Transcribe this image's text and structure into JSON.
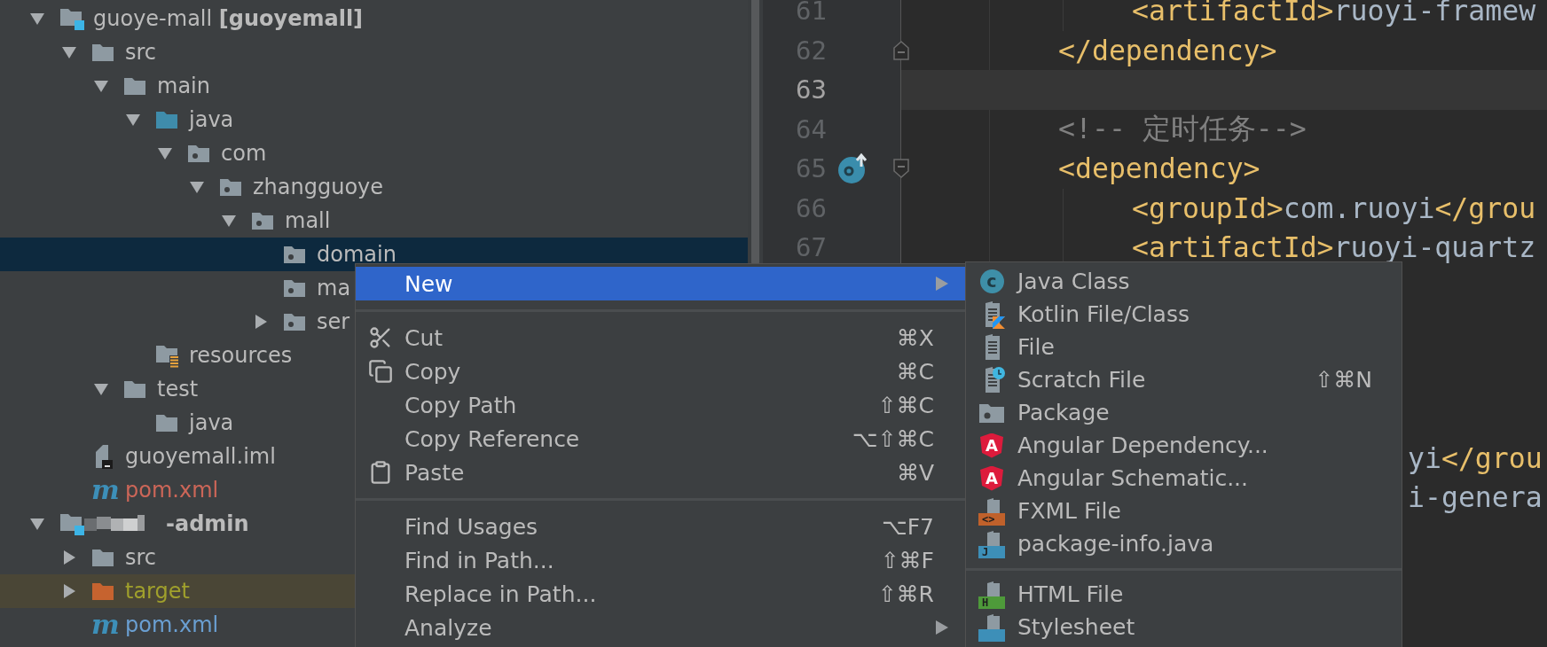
{
  "project_tree": {
    "items": [
      {
        "label": "guoye-mall **[guoyemall]**",
        "kind": "module",
        "expanded": true,
        "selected": false,
        "children": [
          {
            "label": "src",
            "kind": "folder",
            "expanded": true,
            "selected": false,
            "children": [
              {
                "label": "main",
                "kind": "folder",
                "expanded": true,
                "selected": false,
                "children": [
                  {
                    "label": "java",
                    "kind": "source-folder",
                    "expanded": true,
                    "selected": false,
                    "children": [
                      {
                        "label": "com",
                        "kind": "package",
                        "expanded": true,
                        "selected": false,
                        "children": [
                          {
                            "label": "zhangguoye",
                            "kind": "package",
                            "expanded": true,
                            "selected": false,
                            "children": [
                              {
                                "label": "mall",
                                "kind": "package",
                                "expanded": true,
                                "selected": false,
                                "children": [
                                  {
                                    "label": "domain",
                                    "kind": "package",
                                    "selected": true
                                  },
                                  {
                                    "label": "ma",
                                    "kind": "package",
                                    "selected": false
                                  },
                                  {
                                    "label": "ser",
                                    "kind": "package",
                                    "expanded": false,
                                    "selected": false
                                  }
                                ]
                              }
                            ]
                          }
                        ]
                      }
                    ]
                  },
                  {
                    "label": "resources",
                    "kind": "resources",
                    "selected": false
                  }
                ]
              },
              {
                "label": "test",
                "kind": "folder",
                "expanded": true,
                "selected": false,
                "children": [
                  {
                    "label": "java",
                    "kind": "folder",
                    "selected": false
                  }
                ]
              }
            ]
          },
          {
            "label": "guoyemall.iml",
            "kind": "iml",
            "selected": false
          },
          {
            "label": "pom.xml",
            "kind": "maven",
            "badge": "m",
            "color": "#cc6658",
            "selected": false
          }
        ]
      },
      {
        "label": "-admin",
        "kind": "module-redacted",
        "expanded": true,
        "selected": false,
        "children": [
          {
            "label": "src",
            "kind": "folder",
            "expanded": false,
            "selected": false
          },
          {
            "label": "target",
            "kind": "excluded",
            "expanded": false,
            "color": "#a0a02c",
            "selected": false
          },
          {
            "label": "pom.xml",
            "kind": "maven",
            "badge": "m",
            "color": "#6a9fd2",
            "selected": false
          }
        ]
      }
    ]
  },
  "editor": {
    "lines": [
      {
        "number": "61",
        "kind": "nested",
        "current": false,
        "tokens": [
          {
            "kind": "tag",
            "text": "<artifactId>"
          },
          {
            "kind": "text",
            "text": "ruoyi-framew"
          }
        ]
      },
      {
        "number": "62",
        "kind": "fold-end",
        "current": false,
        "tokens": [
          {
            "kind": "tag",
            "text": "</dependency>"
          }
        ]
      },
      {
        "number": "63",
        "kind": "plain",
        "current": true
      },
      {
        "number": "64",
        "kind": "plain",
        "current": false,
        "tokens": [
          {
            "kind": "comment",
            "text": "<!-- 定时任务-->"
          }
        ]
      },
      {
        "number": "65",
        "kind": "fold-start-override",
        "current": false,
        "tokens": [
          {
            "kind": "tag",
            "text": "<dependency>"
          }
        ]
      },
      {
        "number": "66",
        "kind": "nested",
        "current": false,
        "tokens": [
          {
            "kind": "tag",
            "text": "<groupId>"
          },
          {
            "kind": "text",
            "text": "com.ruoyi"
          },
          {
            "kind": "tag",
            "text": "</grou"
          }
        ]
      },
      {
        "number": "67",
        "kind": "nested",
        "current": false,
        "tokens": [
          {
            "kind": "tag",
            "text": "<artifactId>"
          },
          {
            "kind": "text",
            "text": "ruoyi-quartz"
          }
        ]
      }
    ],
    "hidden_lines_fragments": [
      {
        "tokens": [
          {
            "kind": "text",
            "text": "yi"
          },
          {
            "kind": "tag",
            "text": "</grou"
          }
        ]
      },
      {
        "tokens": [
          {
            "kind": "text",
            "text": "i-genera"
          }
        ]
      }
    ]
  },
  "context_menu": {
    "items": [
      {
        "kind": "text",
        "label": "New",
        "submenu": true,
        "selected": true
      },
      {
        "kind": "separator"
      },
      {
        "kind": "scissors",
        "label": "Cut",
        "shortcut": "⌘X",
        "selected": false
      },
      {
        "kind": "copy",
        "label": "Copy",
        "shortcut": "⌘C",
        "selected": false
      },
      {
        "kind": "text",
        "label": "Copy Path",
        "shortcut": "⇧⌘C",
        "selected": false
      },
      {
        "kind": "text",
        "label": "Copy Reference",
        "shortcut": "⌥⇧⌘C",
        "selected": false
      },
      {
        "kind": "clipboard",
        "label": "Paste",
        "shortcut": "⌘V",
        "selected": false
      },
      {
        "kind": "separator"
      },
      {
        "kind": "text",
        "label": "Find Usages",
        "shortcut": "⌥F7",
        "selected": false
      },
      {
        "kind": "text",
        "label": "Find in Path...",
        "shortcut": "⇧⌘F",
        "selected": false
      },
      {
        "kind": "text",
        "label": "Replace in Path...",
        "shortcut": "⇧⌘R",
        "selected": false
      },
      {
        "kind": "text",
        "label": "Analyze",
        "submenu": true,
        "selected": false
      }
    ]
  },
  "new_submenu": {
    "items": [
      {
        "kind": "class",
        "label": "Java Class",
        "glyph": "c"
      },
      {
        "kind": "kotlin",
        "label": "Kotlin File/Class"
      },
      {
        "kind": "file",
        "label": "File"
      },
      {
        "kind": "scratch",
        "label": "Scratch File",
        "shortcut": "⇧⌘N"
      },
      {
        "kind": "package",
        "label": "Package"
      },
      {
        "kind": "angular",
        "label": "Angular Dependency...",
        "glyph": "A"
      },
      {
        "kind": "angular",
        "label": "Angular Schematic...",
        "glyph": "A"
      },
      {
        "kind": "band-file",
        "label": "FXML File",
        "color": "#c0612b",
        "glyph": "<>"
      },
      {
        "kind": "band-file",
        "label": "package-info.java",
        "color": "#3d8fb8",
        "glyph": "J"
      },
      {
        "kind": "separator"
      },
      {
        "kind": "band-file",
        "label": "HTML File",
        "color": "#4e9a3a",
        "glyph": "H"
      },
      {
        "kind": "band-file",
        "label": "Stylesheet",
        "color": "#3d8fb8"
      }
    ]
  }
}
